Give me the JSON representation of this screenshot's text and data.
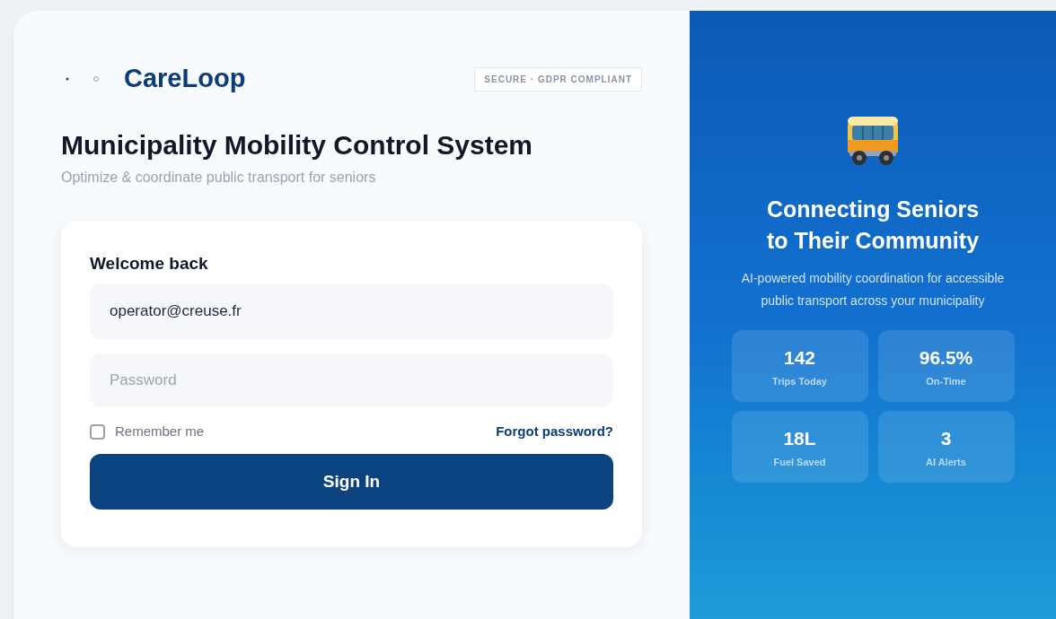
{
  "brand": {
    "name": "CareLoop"
  },
  "badge": "SECURE · GDPR COMPLIANT",
  "title": "Municipality Mobility Control System",
  "subtitle": "Optimize & coordinate public transport for seniors",
  "login": {
    "heading": "Welcome back",
    "email": {
      "value": "operator@creuse.fr"
    },
    "password": {
      "placeholder": "Password"
    },
    "remember": {
      "label": "Remember me",
      "checked": false
    },
    "forgot": "Forgot password?",
    "submit": "Sign In"
  },
  "promo": {
    "heading_lines": [
      "Connecting Seniors",
      "to Their Community"
    ],
    "description": "AI-powered mobility coordination for accessible public transport across your municipality",
    "stats": [
      {
        "value": "142",
        "label": "Trips Today"
      },
      {
        "value": "96.5%",
        "label": "On-Time"
      },
      {
        "value": "18L",
        "label": "Fuel Saved"
      },
      {
        "value": "3",
        "label": "AI Alerts"
      }
    ]
  }
}
